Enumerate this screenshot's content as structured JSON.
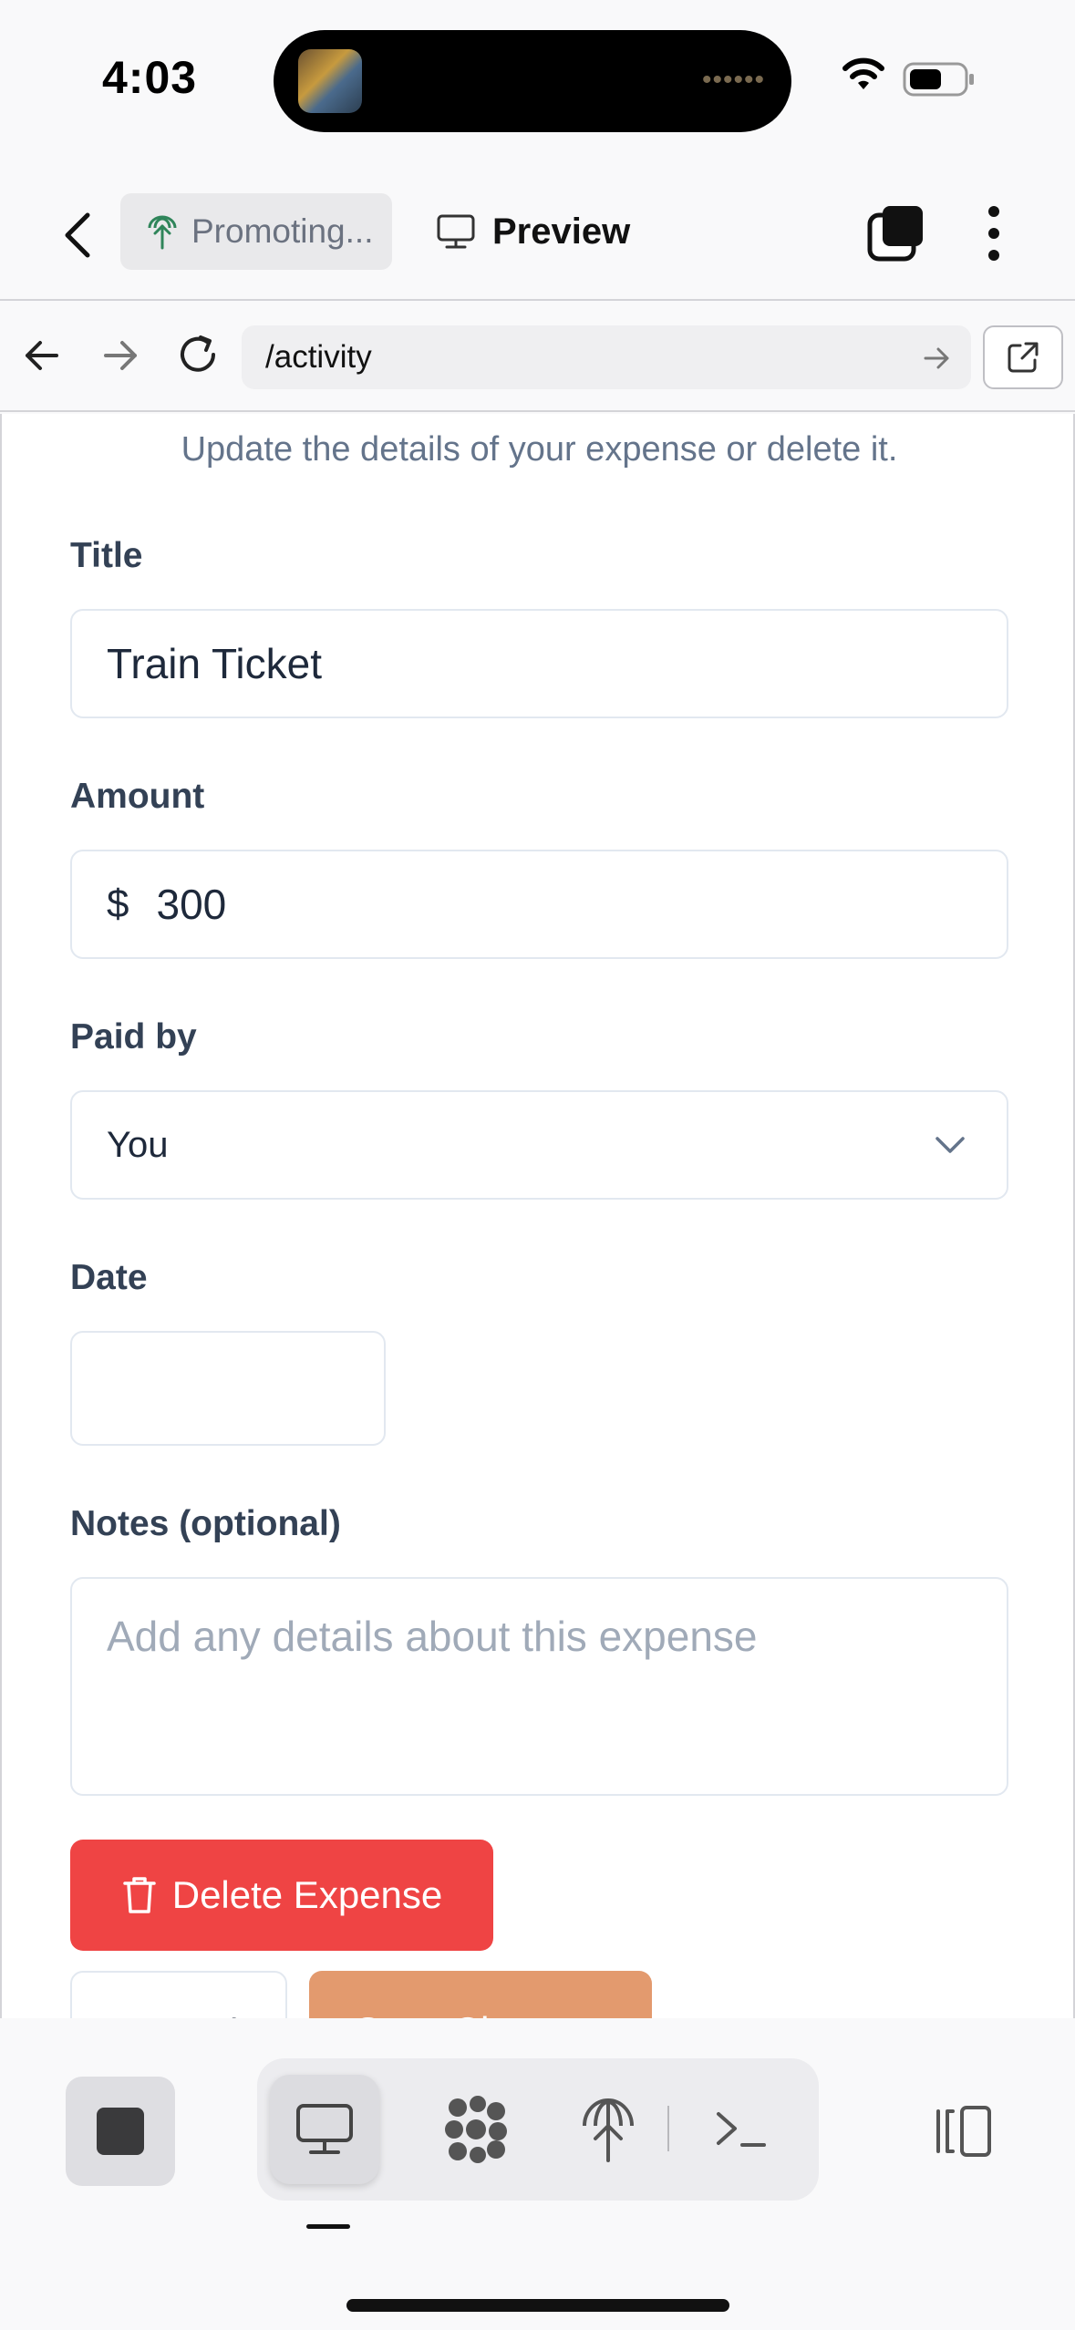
{
  "status_bar": {
    "time": "4:03",
    "island_dots": "••••••"
  },
  "header": {
    "project_label": "Promoting...",
    "preview_label": "Preview"
  },
  "url_bar": {
    "path": "/activity"
  },
  "form": {
    "subtitle": "Update the details of your expense or delete it.",
    "title_label": "Title",
    "title_value": "Train Ticket",
    "amount_label": "Amount",
    "currency_symbol": "$",
    "amount_value": "300",
    "paid_by_label": "Paid by",
    "paid_by_value": "You",
    "date_label": "Date",
    "date_value": "",
    "notes_label": "Notes (optional)",
    "notes_placeholder": "Add any details about this expense",
    "delete_label": "Delete Expense",
    "cancel_label": "Cancel",
    "save_label": "Save Changes"
  },
  "colors": {
    "delete": "#ef4444",
    "save": "#e39a6e",
    "pill_bg": "#e9e9eb"
  },
  "icons": {
    "project": "plant-icon",
    "preview": "monitor-icon",
    "agents": "grid-dots-icon",
    "deploy": "deploy-icon",
    "terminal": "terminal-icon",
    "panel": "panel-toggle-icon"
  }
}
